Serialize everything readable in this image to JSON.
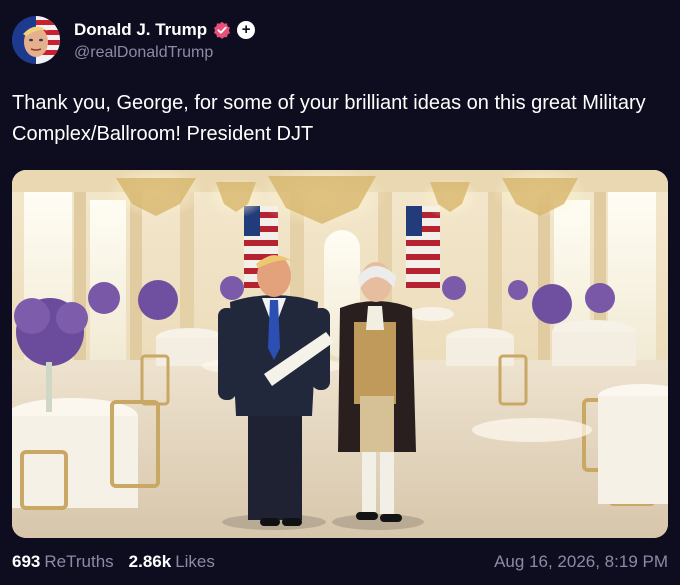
{
  "author": {
    "display_name": "Donald J. Trump",
    "handle": "@realDonaldTrump",
    "verified_icon": "verified-badge-icon",
    "follow_icon": "plus-icon",
    "follow_glyph": "+",
    "verified_color": "#e8507a"
  },
  "post": {
    "text": "Thank you, George, for some of your brilliant ideas on this great Military Complex/Ballroom! President DJT"
  },
  "footer": {
    "retruths_count": "693",
    "retruths_label": "ReTruths",
    "likes_count": "2.86k",
    "likes_label": "Likes",
    "timestamp": "Aug 16, 2026, 8:19 PM"
  },
  "colors": {
    "background": "#0e0d1f",
    "secondary_text": "#8c8aa6"
  }
}
